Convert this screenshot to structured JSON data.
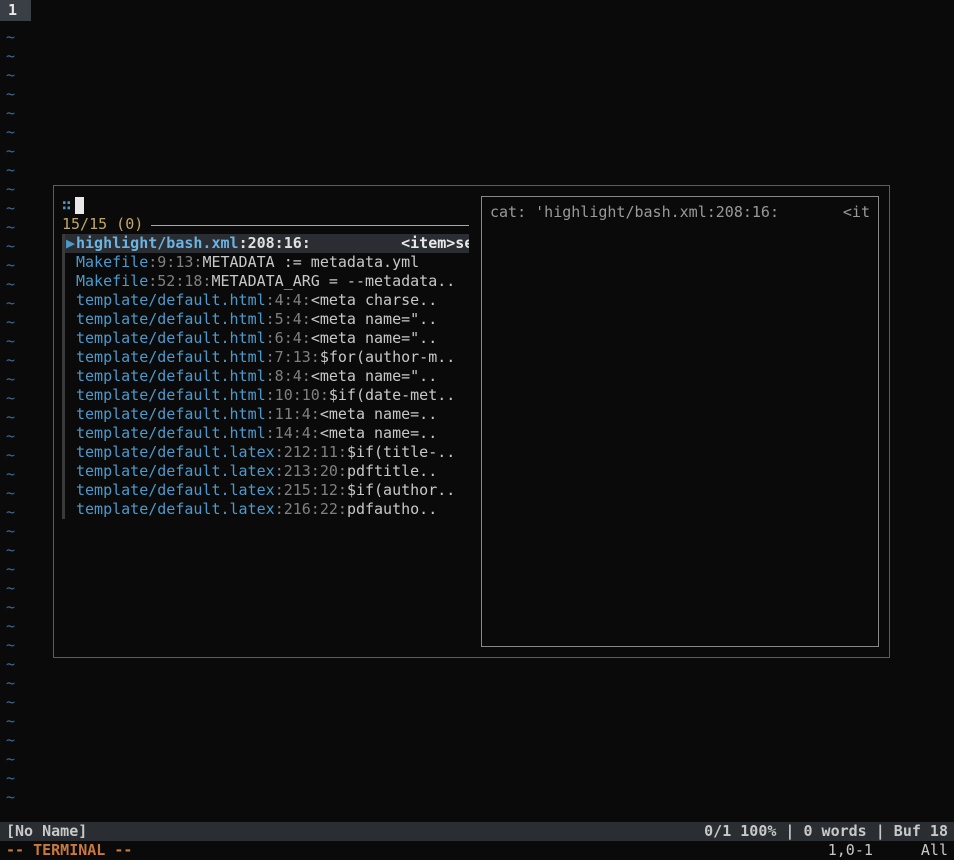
{
  "tab": {
    "label": "1"
  },
  "tildes_count": 41,
  "fzf": {
    "prompt_marker": "∷",
    "count_text": "15/15 (0)",
    "items": [
      {
        "file": "highlight/bash.xml",
        "loc": ":208:16:",
        "content": "<item>se..",
        "pad": 5,
        "selected": true
      },
      {
        "file": "Makefile",
        "loc": ":9:13:",
        "content": "METADATA := metadata.yml",
        "pad": 0,
        "selected": false
      },
      {
        "file": "Makefile",
        "loc": ":52:18:",
        "content": "METADATA_ARG = --metadata..",
        "pad": 0,
        "selected": false
      },
      {
        "file": "template/default.html",
        "loc": ":4:4:",
        "content": "  <meta charse..",
        "pad": 0,
        "selected": false
      },
      {
        "file": "template/default.html",
        "loc": ":5:4:",
        "content": "  <meta name=\"..",
        "pad": 0,
        "selected": false
      },
      {
        "file": "template/default.html",
        "loc": ":6:4:",
        "content": "  <meta name=\"..",
        "pad": 0,
        "selected": false
      },
      {
        "file": "template/default.html",
        "loc": ":7:13:",
        "content": "$for(author-m..",
        "pad": 0,
        "selected": false
      },
      {
        "file": "template/default.html",
        "loc": ":8:4:",
        "content": "  <meta name=\"..",
        "pad": 0,
        "selected": false
      },
      {
        "file": "template/default.html",
        "loc": ":10:10:",
        "content": "$if(date-met..",
        "pad": 0,
        "selected": false
      },
      {
        "file": "template/default.html",
        "loc": ":11:4:",
        "content": "  <meta name=..",
        "pad": 0,
        "selected": false
      },
      {
        "file": "template/default.html",
        "loc": ":14:4:",
        "content": "  <meta name=..",
        "pad": 0,
        "selected": false
      },
      {
        "file": "template/default.latex",
        "loc": ":212:11:",
        "content": "$if(title-..",
        "pad": 0,
        "selected": false
      },
      {
        "file": "template/default.latex",
        "loc": ":213:20:",
        "content": "  pdftitle..",
        "pad": 0,
        "selected": false
      },
      {
        "file": "template/default.latex",
        "loc": ":215:12:",
        "content": "$if(author..",
        "pad": 0,
        "selected": false
      },
      {
        "file": "template/default.latex",
        "loc": ":216:22:",
        "content": "  pdfautho..",
        "pad": 0,
        "selected": false
      }
    ],
    "preview": {
      "left": "cat: 'highlight/bash.xml:208:16:",
      "right": "<it"
    }
  },
  "status": {
    "left": "[No Name]",
    "right": "0/1 100% | 0 words | Buf 18"
  },
  "mode": {
    "text": "-- TERMINAL --",
    "pos": "1,0-1",
    "scroll": "All"
  }
}
